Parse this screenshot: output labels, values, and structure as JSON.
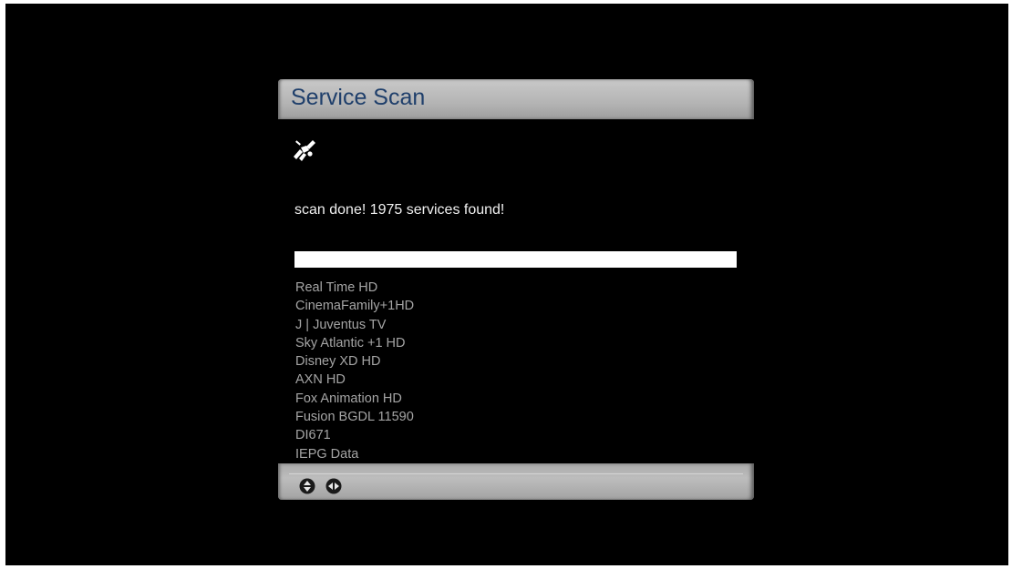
{
  "dialog": {
    "title": "Service Scan",
    "status": "scan done! 1975 services found!",
    "progress_fraction": 1.0,
    "icons": [
      "satellite-icon"
    ],
    "services": [
      "Real Time HD",
      "CinemaFamily+1HD",
      "J | Juventus TV",
      "Sky Atlantic +1 HD",
      "Disney XD HD",
      "AXN HD",
      "Fox Animation HD",
      "Fusion BGDL 11590",
      "DI671",
      "IEPG Data"
    ]
  },
  "button_bar": {
    "icons": [
      "up-down-arrows-icon",
      "left-right-arrows-icon"
    ]
  },
  "colors": {
    "background": "#000000",
    "title_text": "#1f3f6b",
    "title_bar": "#b4b4b4",
    "status_text": "#f0f0f0",
    "list_text": "#a5a5a5",
    "progress_fill": "#ffffff"
  }
}
